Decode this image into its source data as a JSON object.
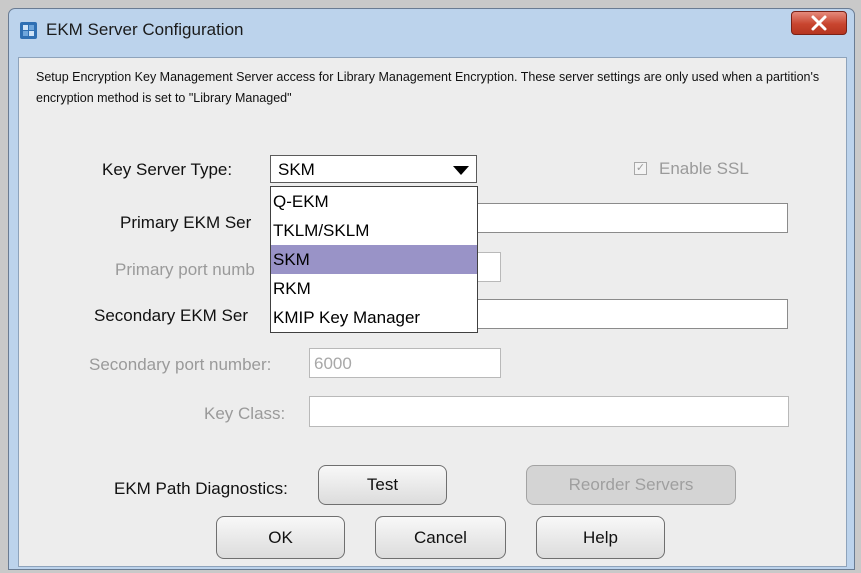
{
  "window": {
    "title": "EKM Server Configuration",
    "description": "Setup Encryption Key Management Server access for Library Management Encryption. These server settings are only used when a partition's encryption method is set to \"Library Managed\""
  },
  "form": {
    "key_server_type_label": "Key Server Type:",
    "key_server_type_value": "SKM",
    "enable_ssl_label": "Enable SSL",
    "enable_ssl_checked": true,
    "primary_server_label": "Primary EKM Ser",
    "primary_port_label": "Primary port numb",
    "secondary_server_label": "Secondary EKM Ser",
    "secondary_port_label": "Secondary port number:",
    "secondary_port_value": "6000",
    "key_class_label": "Key Class:",
    "diagnostics_label": "EKM Path Diagnostics:"
  },
  "dropdown": {
    "options": [
      "Q-EKM",
      "TKLM/SKLM",
      "SKM",
      "RKM",
      "KMIP Key Manager"
    ],
    "selected_index": 2
  },
  "buttons": {
    "test": "Test",
    "reorder": "Reorder Servers",
    "ok": "OK",
    "cancel": "Cancel",
    "help": "Help"
  }
}
